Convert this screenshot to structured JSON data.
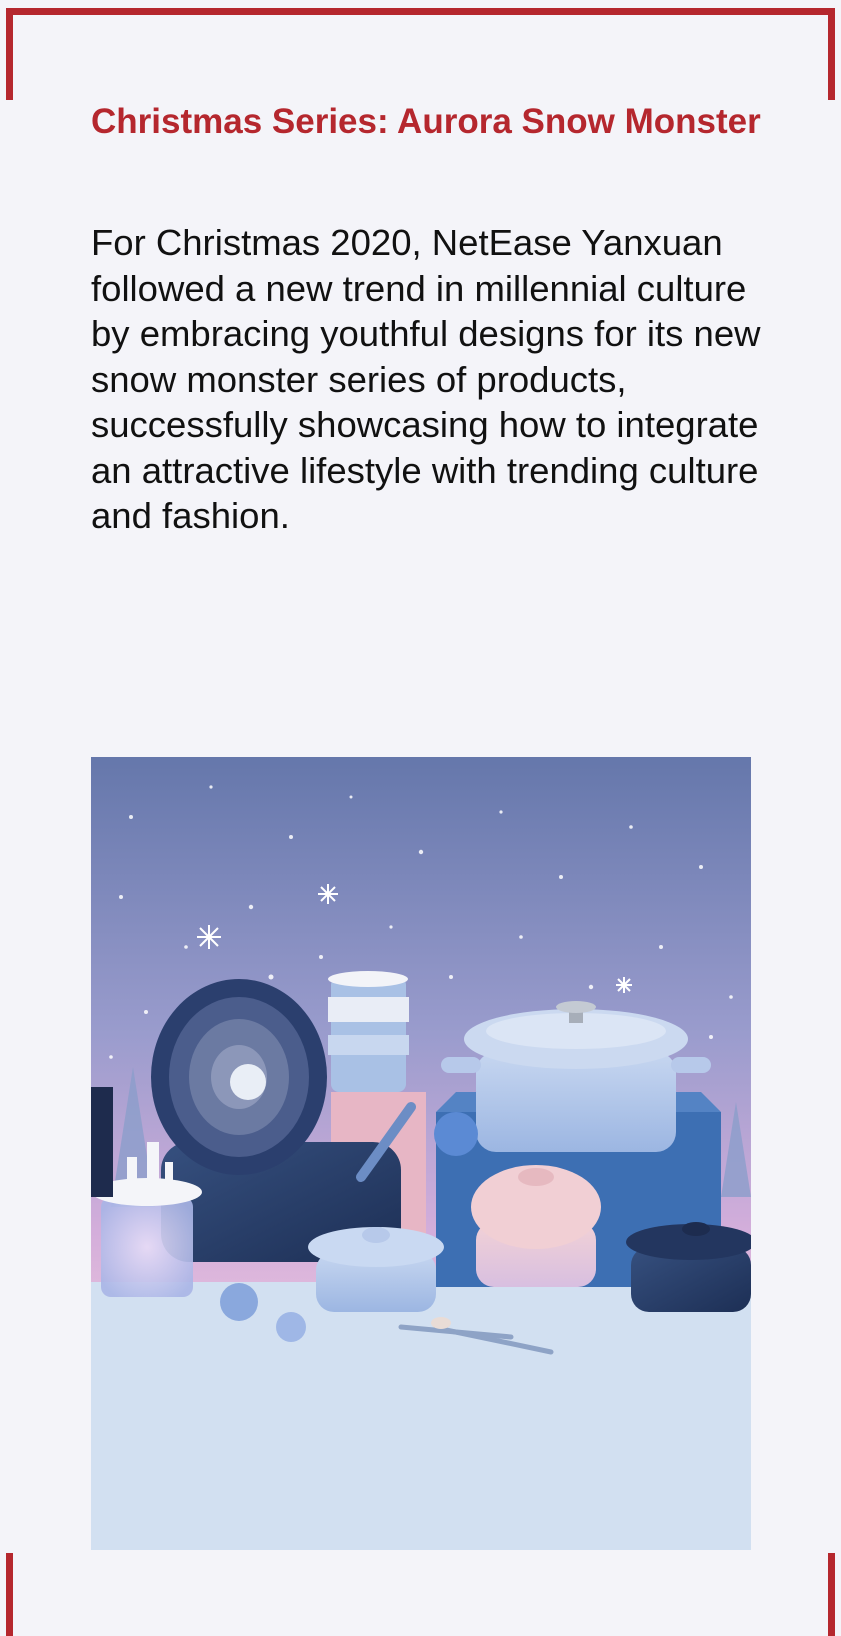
{
  "article": {
    "title": "Christmas Series: Aurora Snow Monster",
    "body": "For Christmas 2020, NetEase Yanxuan followed a new trend in millennial culture by embracing youthful designs for its new snow monster series of products, successfully showcasing how to integrate an attractive lifestyle with trending culture and fashion."
  },
  "colors": {
    "accent": "#b5272e",
    "background": "#f4f4f9",
    "sky_top": "#6a7fb0",
    "sky_bottom": "#e6b9d8",
    "table": "#d3e1f1"
  },
  "image": {
    "subject": "product-photo-cookware"
  }
}
